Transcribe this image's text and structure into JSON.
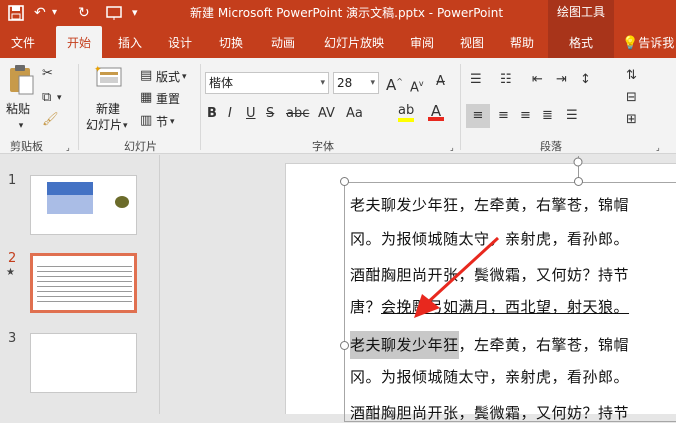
{
  "titlebar": {
    "doc_title": "新建 Microsoft PowerPoint 演示文稿.pptx  -  PowerPoint",
    "tools_title": "绘图工具"
  },
  "tabs": [
    "文件",
    "开始",
    "插入",
    "设计",
    "切换",
    "动画",
    "幻灯片放映",
    "审阅",
    "视图",
    "帮助",
    "格式"
  ],
  "tell_me": "告诉我",
  "ribbon": {
    "paste": "粘贴",
    "new_slide_1": "新建",
    "new_slide_2": "幻灯片",
    "layout": "版式",
    "reset": "重置",
    "section": "节",
    "font_name": "楷体",
    "font_size": "28",
    "groups": {
      "clipboard": "剪贴板",
      "slides": "幻灯片",
      "font": "字体",
      "paragraph": "段落"
    }
  },
  "slides": [
    "1",
    "2",
    "3"
  ],
  "slide_text": {
    "line1": "老夫聊发少年狂，左牵黄，右擎苍，锦帽",
    "line2": "冈。为报倾城随太守，亲射虎，看孙郎。",
    "line3": "酒酣胸胆尚开张，鬓微霜，又何妨？持节",
    "line4_a": "唐？",
    "line4_b": "会挽雕弓如满月，西北望，射天狼。",
    "line5_sel": "老夫聊发少年狂",
    "line5_rest": "，左牵黄，右擎苍，锦帽",
    "line6": "冈。为报倾城随太守，亲射虎，看孙郎。",
    "line7": "酒酣胸胆尚开张，鬓微霜，又何妨？持节"
  },
  "colors": {
    "accent": "#c43e1c",
    "selection": "#c8c8c8",
    "arrow": "#e8281e"
  }
}
